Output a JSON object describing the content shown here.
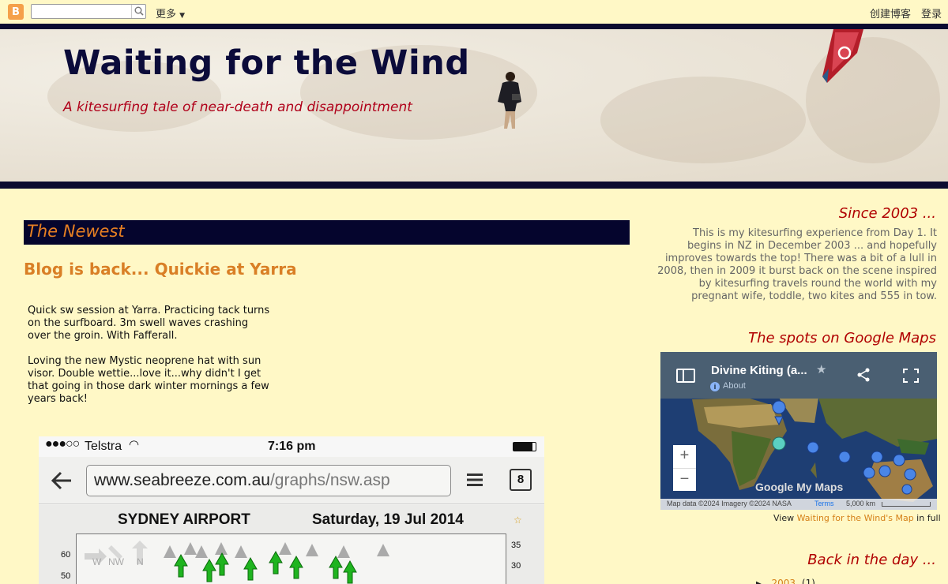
{
  "navbar": {
    "more_label": "更多",
    "create_blog_label": "创建博客",
    "login_label": "登录",
    "search_placeholder": ""
  },
  "header": {
    "title": "Waiting for the Wind",
    "subtitle": "A kitesurfing tale of near-death and disappointment"
  },
  "main": {
    "date_header": "The Newest",
    "post": {
      "title": "Blog is back... Quickie at Yarra",
      "paragraphs": [
        "Quick sw session at Yarra. Practicing tack turns on the surfboard. 3m swell waves crashing over the groin. With Fafferall.",
        "Loving the new Mystic neoprene hat with sun visor. Double wettie...love it...why didn't I get that going in those dark winter mornings a few years back!"
      ],
      "image": {
        "carrier": "Telstra",
        "time": "7:16 pm",
        "url_main": "www.seabreeze.com.au",
        "url_path": "/graphs/nsw.asp",
        "tab_count": "8",
        "station": "SYDNEY AIRPORT",
        "date": "Saturday, 19 Jul 2014",
        "left_ticks": [
          "60",
          "50"
        ],
        "right_ticks": [
          "35",
          "30"
        ],
        "dir_labels": [
          "W",
          "NW",
          "N"
        ]
      }
    }
  },
  "sidebar": {
    "about_heading": "Since 2003 ...",
    "about_text": "This is my kitesurfing experience from Day 1. It begins in NZ in December 2003 ... and hopefully improves towards the top! There was a bit of a lull in 2008, then in 2009 it burst back on the scene inspired by kitesurfing travels round the world with my pregnant wife, toddle, two kites and 555 in tow.",
    "maps_heading": "The spots on Google Maps",
    "map": {
      "title": "Divine Kiting (a...",
      "about": "About",
      "zoom_in": "+",
      "zoom_out": "−",
      "brand": "Google My Maps",
      "attribution": "Map data ©2024 Imagery ©2024 NASA",
      "terms": "Terms",
      "scale": "5,000 km"
    },
    "map_caption": {
      "prefix": "View ",
      "link": "Waiting for the Wind's Map",
      "suffix": " in full"
    },
    "archive_heading": "Back in the day ...",
    "archive_year": "2003",
    "archive_count": "(1)"
  },
  "colors": {
    "background": "#fff8c6",
    "header_band": "#0b0b30",
    "accent_orange": "#d97f26",
    "sidebar_red": "#b00000"
  }
}
